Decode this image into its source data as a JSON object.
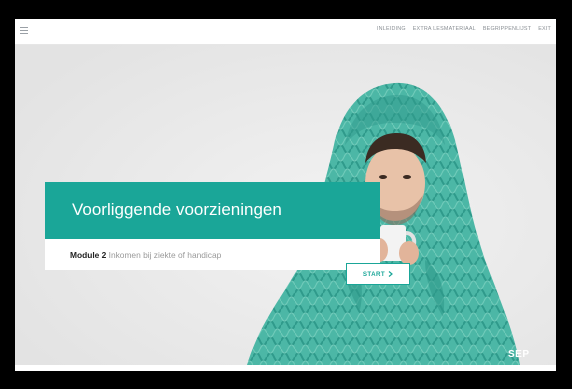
{
  "topbar": {
    "menu_icon": "hamburger-icon",
    "nav": [
      "Inleiding",
      "Extra lesmateriaal",
      "Begrippenlijst",
      "Exit"
    ]
  },
  "hero": {
    "title": "Voorliggende voorzieningen",
    "module_label": "Module 2",
    "module_title": "Inkomen bij ziekte of handicap",
    "start_label": "START",
    "start_icon": "chevron-right-icon",
    "logo_text": "SEP",
    "accent_color": "#1aa698"
  }
}
